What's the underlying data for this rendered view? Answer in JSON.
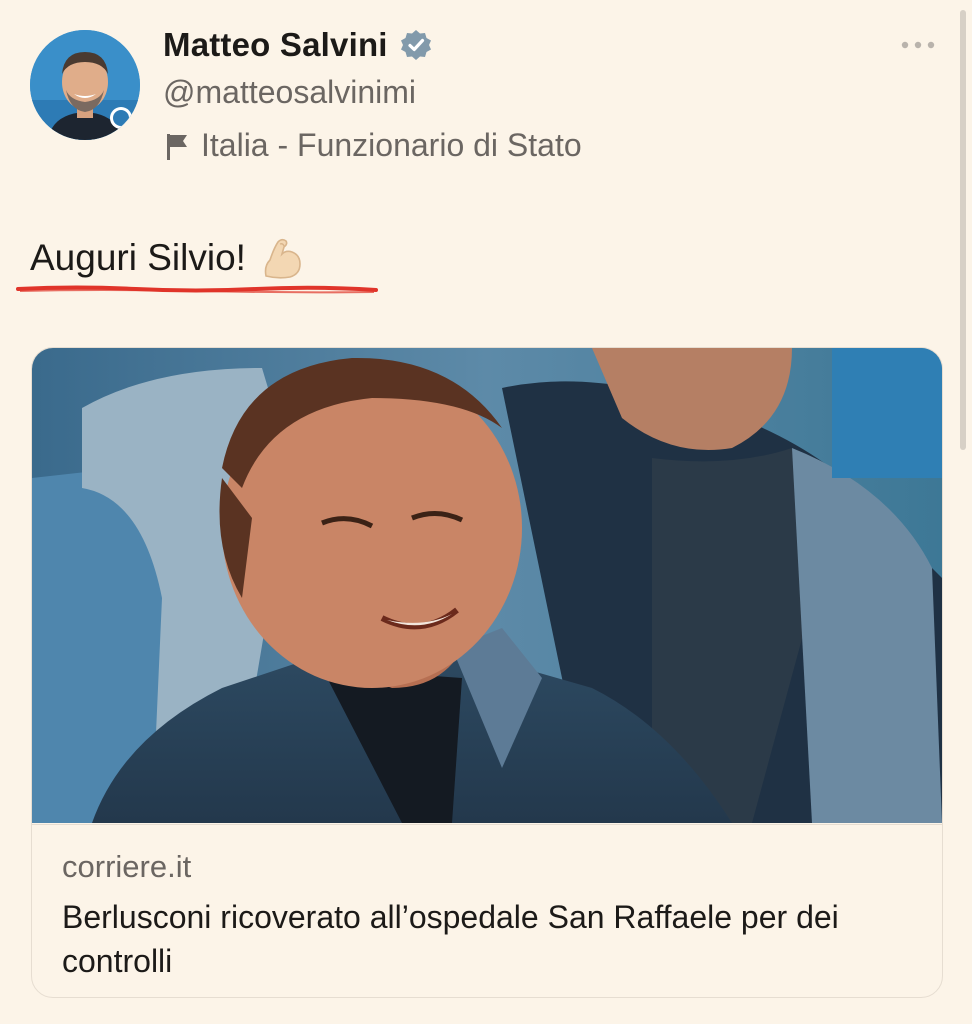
{
  "tweet": {
    "author": {
      "display_name": "Matteo Salvini",
      "handle": "@matteosalvinimi",
      "verified_icon": "verified-badge-icon",
      "location_icon": "flag-icon",
      "location": "Italia - Funzionario di Stato"
    },
    "text": "Auguri Silvio!",
    "emoji_icon": "flexed-biceps-icon",
    "link_card": {
      "domain": "corriere.it",
      "title": "Berlusconi ricoverato all’ospedale San Raffaele per dei controlli"
    }
  },
  "colors": {
    "background": "#fcf4e8",
    "primary_text": "#1c1a18",
    "secondary_text": "#6b6662",
    "annotation_red": "#e0342a",
    "verified_badge": "#829aab"
  }
}
